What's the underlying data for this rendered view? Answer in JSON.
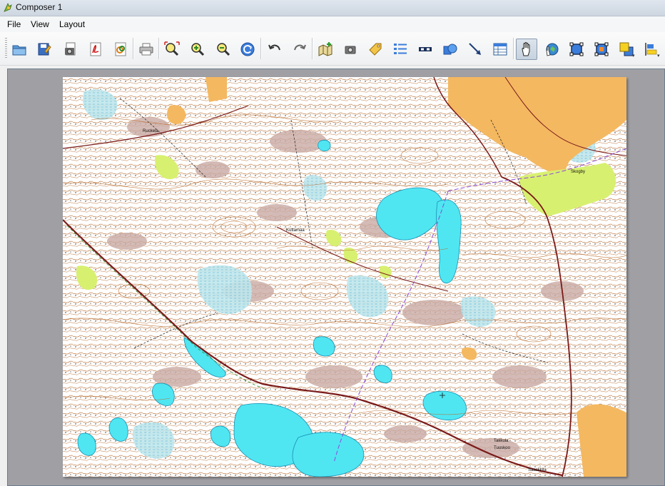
{
  "window": {
    "title": "Composer 1",
    "app_icon": "qgis-icon"
  },
  "menu": {
    "items": [
      "File",
      "View",
      "Layout"
    ]
  },
  "toolbar": {
    "buttons": [
      {
        "name": "open-template-icon",
        "tooltip": "Load from template"
      },
      {
        "name": "save-template-icon",
        "tooltip": "Save as template"
      },
      {
        "name": "export-image-icon",
        "tooltip": "Export as image"
      },
      {
        "name": "export-pdf-icon",
        "tooltip": "Export as PDF"
      },
      {
        "name": "export-svg-icon",
        "tooltip": "Export as SVG"
      },
      {
        "name": "print-icon",
        "tooltip": "Print"
      },
      {
        "name": "zoom-full-icon",
        "tooltip": "Zoom full"
      },
      {
        "name": "zoom-in-icon",
        "tooltip": "Zoom in"
      },
      {
        "name": "zoom-out-icon",
        "tooltip": "Zoom out"
      },
      {
        "name": "refresh-icon",
        "tooltip": "Refresh view"
      },
      {
        "name": "undo-icon",
        "tooltip": "Undo"
      },
      {
        "name": "redo-icon",
        "tooltip": "Redo"
      },
      {
        "name": "add-map-icon",
        "tooltip": "Add new map"
      },
      {
        "name": "add-image-icon",
        "tooltip": "Add image"
      },
      {
        "name": "add-label-icon",
        "tooltip": "Add new label"
      },
      {
        "name": "add-legend-icon",
        "tooltip": "Add new legend"
      },
      {
        "name": "add-scalebar-icon",
        "tooltip": "Add new scalebar"
      },
      {
        "name": "add-shape-icon",
        "tooltip": "Add basic shape"
      },
      {
        "name": "add-arrow-icon",
        "tooltip": "Add arrow"
      },
      {
        "name": "add-table-icon",
        "tooltip": "Add attribute table"
      },
      {
        "name": "select-move-item-icon",
        "tooltip": "Select/Move item",
        "active": true
      },
      {
        "name": "move-item-content-icon",
        "tooltip": "Move item content"
      },
      {
        "name": "group-items-icon",
        "tooltip": "Group items"
      },
      {
        "name": "ungroup-items-icon",
        "tooltip": "Ungroup items"
      },
      {
        "name": "raise-items-icon",
        "tooltip": "Raise selected items"
      },
      {
        "name": "align-items-icon",
        "tooltip": "Align selected items"
      }
    ]
  },
  "map": {
    "labels": [
      "Ruckela",
      "Kuttamaa",
      "Skogby",
      "Takkula",
      "Tuuskoo",
      "Saaskkila"
    ],
    "colors": {
      "water": "#4fe6f2",
      "marsh": "#9ad6e0",
      "field": "#f4b860",
      "meadow": "#d8f070",
      "rock": "#c9aaa4",
      "contour": "#b86a2a",
      "road": "#7a1a1a",
      "powerline": "#8a4ad8",
      "path": "#222222"
    }
  }
}
